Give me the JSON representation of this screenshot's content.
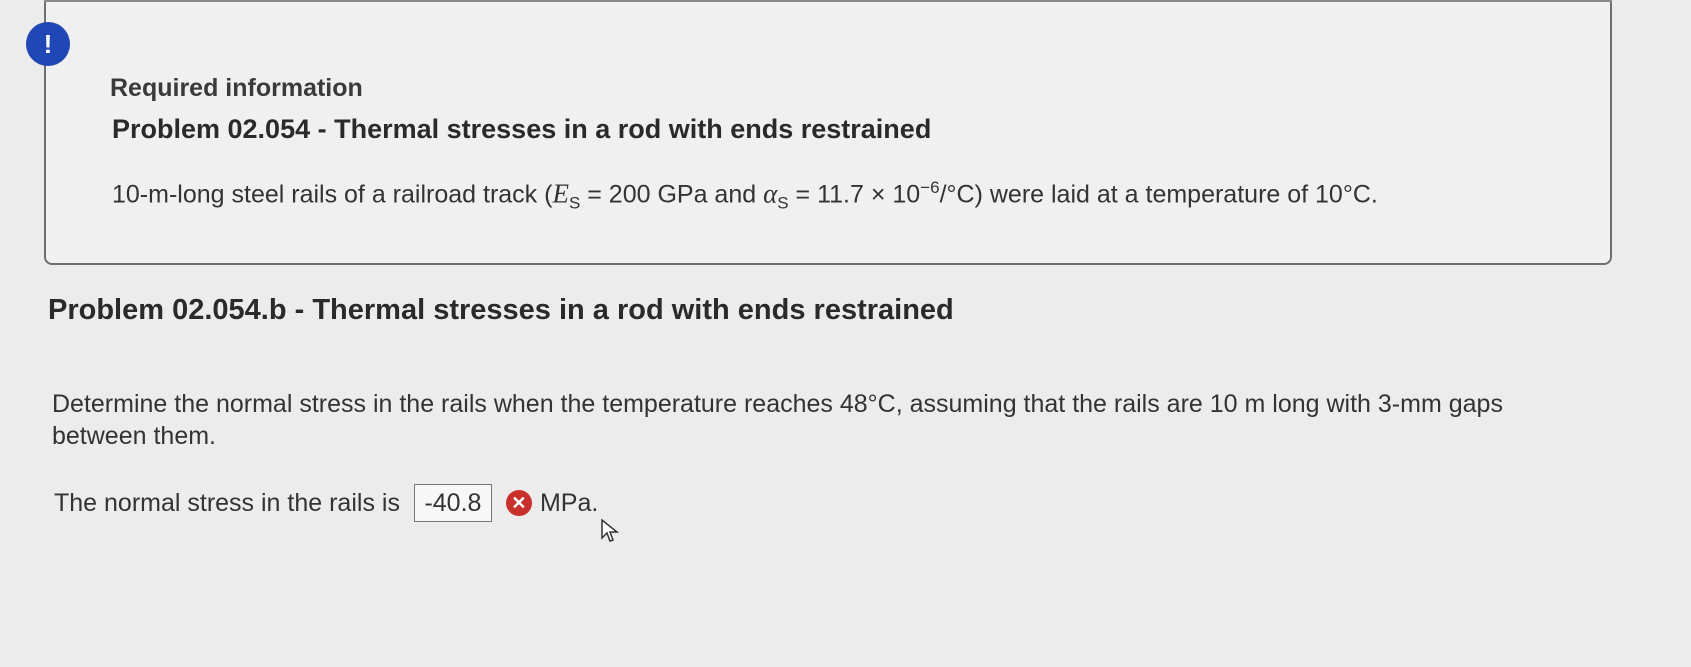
{
  "alert": {
    "symbol": "!"
  },
  "info": {
    "heading": "Required information",
    "problem_title": "Problem 02.054 - Thermal stresses in a rod with ends restrained",
    "given_prefix": "10-m-long steel rails of a railroad track (",
    "e_symbol": "E",
    "e_sub": "S",
    "e_value": " = 200 GPa and ",
    "alpha_symbol": "α",
    "alpha_sub": "S",
    "alpha_value": " = 11.7 × 10",
    "alpha_exp": "−6",
    "alpha_unit": "/°C) were laid at a temperature of 10°C."
  },
  "part": {
    "title": "Problem 02.054.b - Thermal stresses in a rod with ends restrained",
    "question": "Determine the normal stress in the rails when the temperature reaches 48°C, assuming that the rails are 10 m long with 3-mm gaps between them.",
    "answer_prefix": "The normal stress in the rails is",
    "answer_value": "-40.8",
    "answer_unit": "MPa.",
    "status": "incorrect"
  }
}
